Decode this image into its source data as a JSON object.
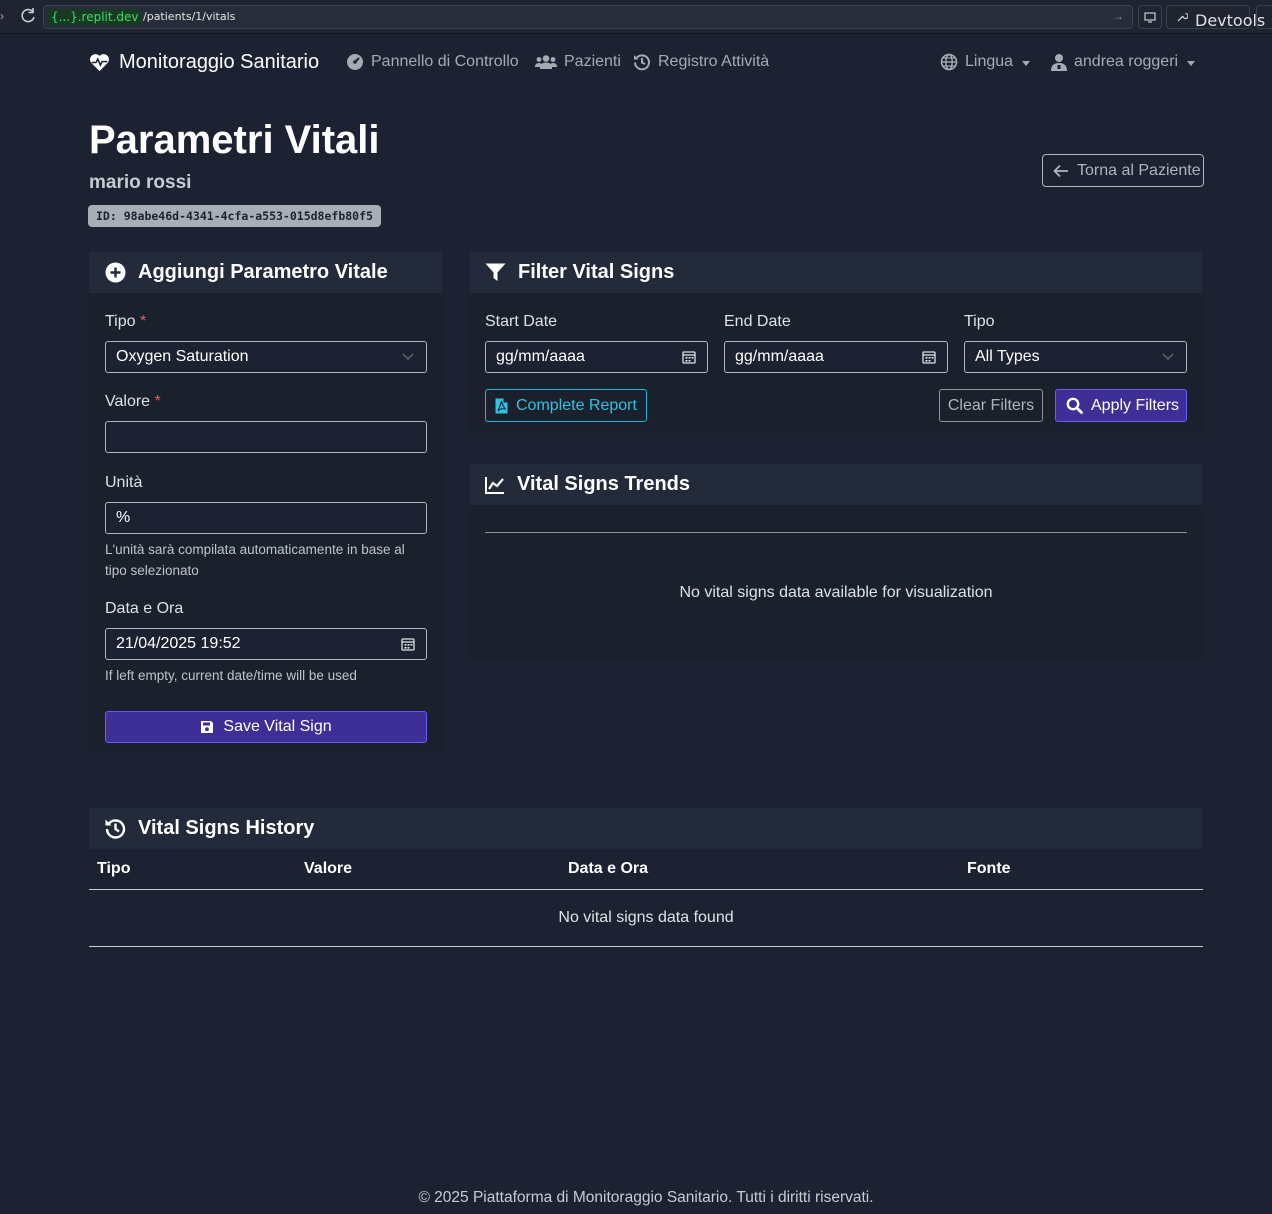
{
  "browser": {
    "url_host": "{...}.replit.dev",
    "url_path": "/patients/1/vitals",
    "devtools_label": "Devtools"
  },
  "nav": {
    "brand": "Monitoraggio Sanitario",
    "dashboard": "Pannello di Controllo",
    "patients": "Pazienti",
    "activity_log": "Registro Attività",
    "language": "Lingua",
    "user": "andrea roggeri"
  },
  "header": {
    "title": "Parametri Vitali",
    "patient_name": "mario rossi",
    "patient_id": "ID: 98abe46d-4341-4cfa-a553-015d8efb80f5",
    "back_button": "Torna al Paziente"
  },
  "add_form": {
    "title": "Aggiungi Parametro Vitale",
    "type_label": "Tipo",
    "required_mark": "*",
    "type_value": "Oxygen Saturation",
    "value_label": "Valore",
    "value_value": "",
    "unit_label": "Unità",
    "unit_value": "%",
    "unit_help": "L'unità sarà compilata automaticamente in base al tipo selezionato",
    "datetime_label": "Data e Ora",
    "datetime_value": "21/04/2025 19:52",
    "datetime_help": "If left empty, current date/time will be used",
    "save_button": "Save Vital Sign"
  },
  "filter": {
    "title": "Filter Vital Signs",
    "start_label": "Start Date",
    "start_placeholder": "gg/mm/aaaa",
    "end_label": "End Date",
    "end_placeholder": "gg/mm/aaaa",
    "type_label": "Tipo",
    "type_value": "All Types",
    "report_button": "Complete Report",
    "clear_button": "Clear Filters",
    "apply_button": "Apply Filters"
  },
  "trends": {
    "title": "Vital Signs Trends",
    "empty": "No vital signs data available for visualization"
  },
  "history": {
    "title": "Vital Signs History",
    "columns": [
      "Tipo",
      "Valore",
      "Data e Ora",
      "Fonte"
    ],
    "empty": "No vital signs data found"
  },
  "footer": "© 2025 Piattaforma di Monitoraggio Sanitario. Tutti i diritti riservati."
}
